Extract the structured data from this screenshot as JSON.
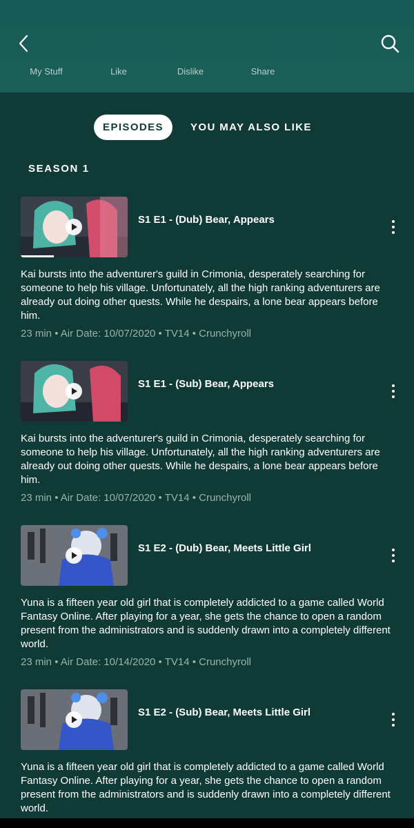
{
  "header": {
    "back_icon": "back-chevron-icon",
    "search_icon": "search-icon",
    "actions": [
      "My Stuff",
      "Like",
      "Dislike",
      "Share"
    ]
  },
  "tabs": {
    "active": "EPISODES",
    "other": "YOU MAY ALSO LIKE"
  },
  "season_label": "SEASON 1",
  "episodes": [
    {
      "title": "S1 E1 - (Dub) Bear, Appears",
      "description": "Kai bursts into the adventurer's guild in Crimonia, desperately searching for someone to help his village. Unfortunately, all the high ranking adventurers are already out doing other quests. While he despairs, a lone bear appears before him.",
      "meta": "23 min • Air Date: 10/07/2020 • TV14 • Crunchyroll",
      "watched_progress": 0.31
    },
    {
      "title": "S1 E1 - (Sub) Bear, Appears",
      "description": "Kai bursts into the adventurer's guild in Crimonia, desperately searching for someone to help his village. Unfortunately, all the high ranking adventurers are already out doing other quests. While he despairs, a lone bear appears before him.",
      "meta": "23 min • Air Date: 10/07/2020 • TV14 • Crunchyroll"
    },
    {
      "title": "S1 E2 - (Dub) Bear, Meets Little Girl",
      "description": "Yuna is a fifteen year old girl that is completely addicted to a game called World Fantasy Online. After playing for a year, she gets the chance to open a random present from the administrators and is suddenly drawn into a completely different world.",
      "meta": "23 min • Air Date: 10/14/2020 • TV14 • Crunchyroll"
    },
    {
      "title": "S1 E2 - (Sub) Bear, Meets Little Girl",
      "description": "Yuna is a fifteen year old girl that is completely addicted to a game called World Fantasy Online. After playing for a year, she gets the chance to open a random present from the administrators and is suddenly drawn into a completely different world."
    }
  ]
}
